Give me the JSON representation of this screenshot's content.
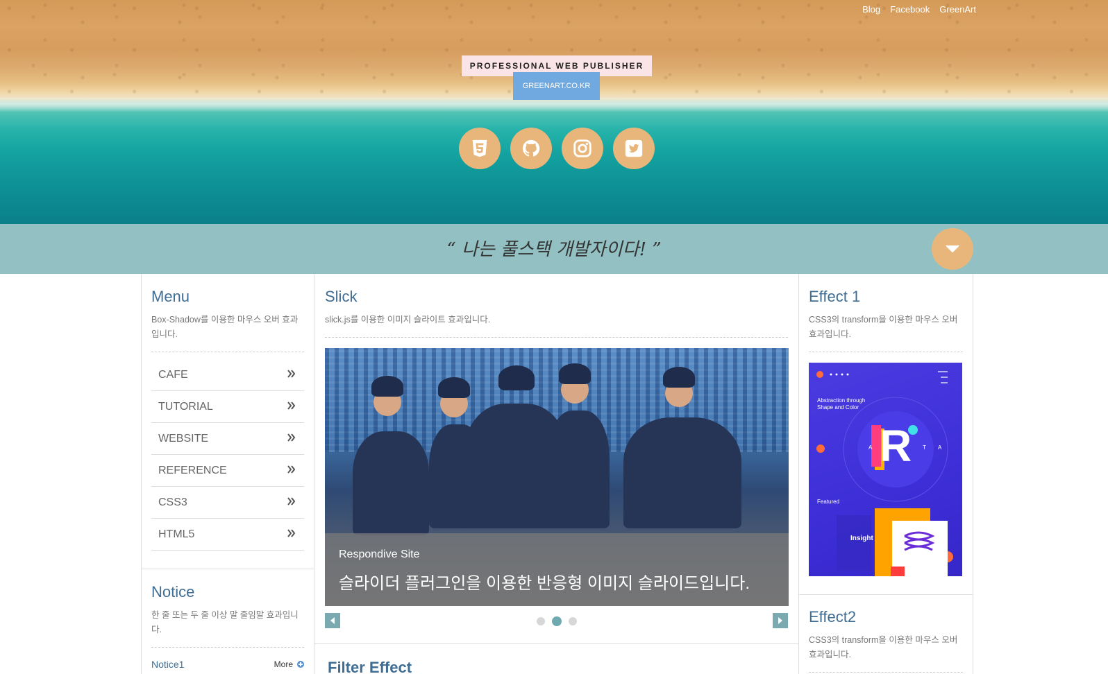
{
  "header": {
    "top_links": [
      "Blog",
      "Facebook",
      "GreenArt"
    ],
    "tagline": "PROFESSIONAL WEB PUBLISHER",
    "site_button": "GREENART.CO.KR",
    "socials": [
      "html5-icon",
      "github-icon",
      "instagram-icon",
      "twitter-icon"
    ]
  },
  "quote": {
    "text": "“ 나는 풀스택 개발자이다! ”"
  },
  "menu": {
    "title": "Menu",
    "desc": "Box-Shadow를 이용한 마우스 오버 효과입니다.",
    "items": [
      {
        "label": "CAFE"
      },
      {
        "label": "TUTORIAL"
      },
      {
        "label": "WEBSITE"
      },
      {
        "label": "REFERENCE"
      },
      {
        "label": "CSS3"
      },
      {
        "label": "HTML5"
      }
    ]
  },
  "notice": {
    "title": "Notice",
    "desc": "한 줄 또는 두 줄 이상 말 줄임말 효과입니다.",
    "first_item": "Notice1",
    "more_label": "More"
  },
  "slick": {
    "title": "Slick",
    "desc": "slick.js를 이용한 이미지 슬라이트 효과입니다.",
    "caption_title": "Respondive Site",
    "caption_desc": "슬라이더 플러그인을 이용한 반응형 이미지 슬라이드입니다.",
    "dots": 3,
    "active_dot": 1
  },
  "filter": {
    "title": "Filter Effect"
  },
  "effect1": {
    "title": "Effect 1",
    "desc": "CSS3의 transform을 이용한 마우스 오버 효과입니다.",
    "image_text": {
      "headline": "Abstraction through Shape and Color",
      "letter_main": "R",
      "letter_left": "A",
      "letter_right": "T",
      "letter_far": "A",
      "featured": "Featured",
      "insight": "Insight"
    }
  },
  "effect2": {
    "title": "Effect2",
    "desc": "CSS3의 transform을 이용한 마우스 오버 효과입니다."
  },
  "colors": {
    "accent_orange": "#e8b67a",
    "quote_bar": "#93c1c3",
    "title_blue": "#3f6d93",
    "site_button": "#6fa9e0"
  }
}
